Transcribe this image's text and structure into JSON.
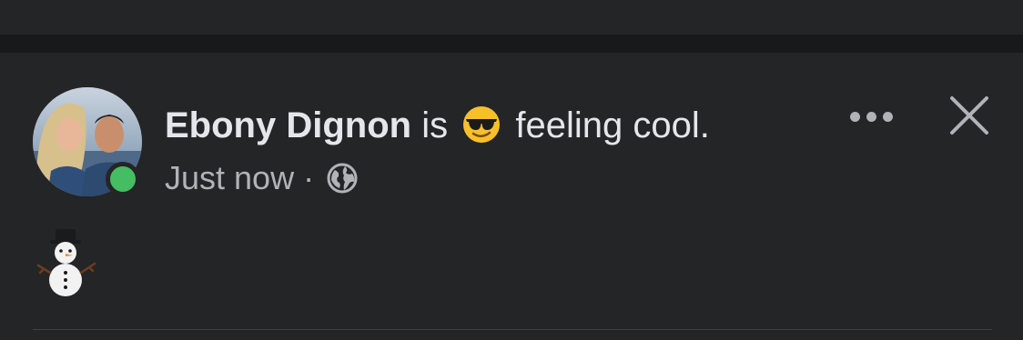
{
  "post": {
    "author": "Ebony Dignon",
    "activity_prefix": "is",
    "feeling_emoji": "sunglasses-emoji",
    "feeling_text": "feeling cool.",
    "timestamp": "Just now",
    "meta_separator": "·",
    "privacy_icon": "globe-icon",
    "online": true,
    "body_emoji": "snowman-emoji"
  },
  "controls": {
    "more_icon": "more-options-icon",
    "close_icon": "close-icon"
  },
  "colors": {
    "background": "#242526",
    "separator": "#18191a",
    "primary_text": "#e4e6eb",
    "secondary_text": "#b0b3b8",
    "online_dot": "#45bd62",
    "divider": "#3e4042"
  }
}
